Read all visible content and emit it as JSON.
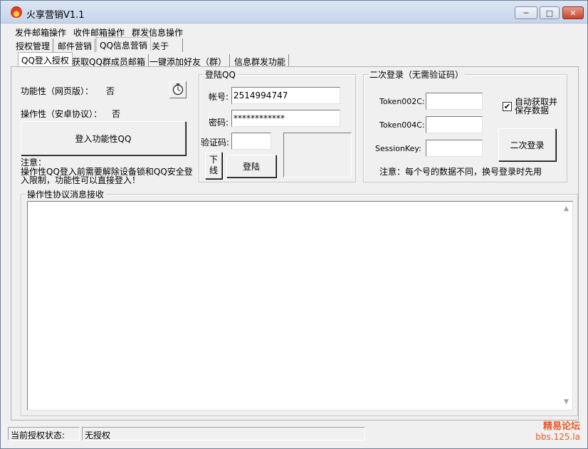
{
  "window": {
    "title": "火享营销V1.1",
    "controls": {
      "minimize": "─",
      "maximize": "□",
      "close": "✕"
    }
  },
  "menu": [
    "发件邮箱操作",
    "收件邮箱操作",
    "群发信息操作"
  ],
  "top_tabs": [
    "授权管理",
    "邮件营销",
    "QQ信息营销",
    "关于"
  ],
  "sub_tabs": [
    "QQ登入授权",
    "获取QQ群成员邮箱",
    "一键添加好友（群）",
    "信息群发功能"
  ],
  "left": {
    "func_label": "功能性（网页版）：",
    "func_value": "否",
    "op_label": "操作性（安卓协议）：",
    "op_value": "否",
    "login_func_button": "登入功能性QQ",
    "note_title": "注意：",
    "note_line1": "操作性QQ登入前需要解除设备锁和QQ安全登",
    "note_line2": "入限制，功能性可以直接登入！"
  },
  "login_group": {
    "title": "登陆QQ",
    "account_label": "帐号:",
    "account_value": "2514994747",
    "password_label": "密码:",
    "password_value": "************",
    "captcha_label": "验证码:",
    "captcha_value": "",
    "offline_button_l1": "下",
    "offline_button_l2": "线",
    "login_button": "登陆"
  },
  "second_login": {
    "title": "二次登录（无需验证码）",
    "token002c_label": "Token002C:",
    "token004c_label": "Token004C:",
    "sessionkey_label": "SessionKey:",
    "auto_fetch_l1": "自动获取并",
    "auto_fetch_l2": "保存数据",
    "auto_fetch_checked": true,
    "check_mark": "✔",
    "second_login_button": "二次登录",
    "note": "注意：每个号的数据不同，换号登录时先用"
  },
  "message_group": {
    "title": "操作性协议消息接收",
    "scroll_up": "▲",
    "scroll_down": "▼"
  },
  "status": {
    "label": "当前授权状态:",
    "value": "无授权"
  },
  "watermark": {
    "line1": "精易论坛",
    "line2": "bbs.125.la"
  }
}
